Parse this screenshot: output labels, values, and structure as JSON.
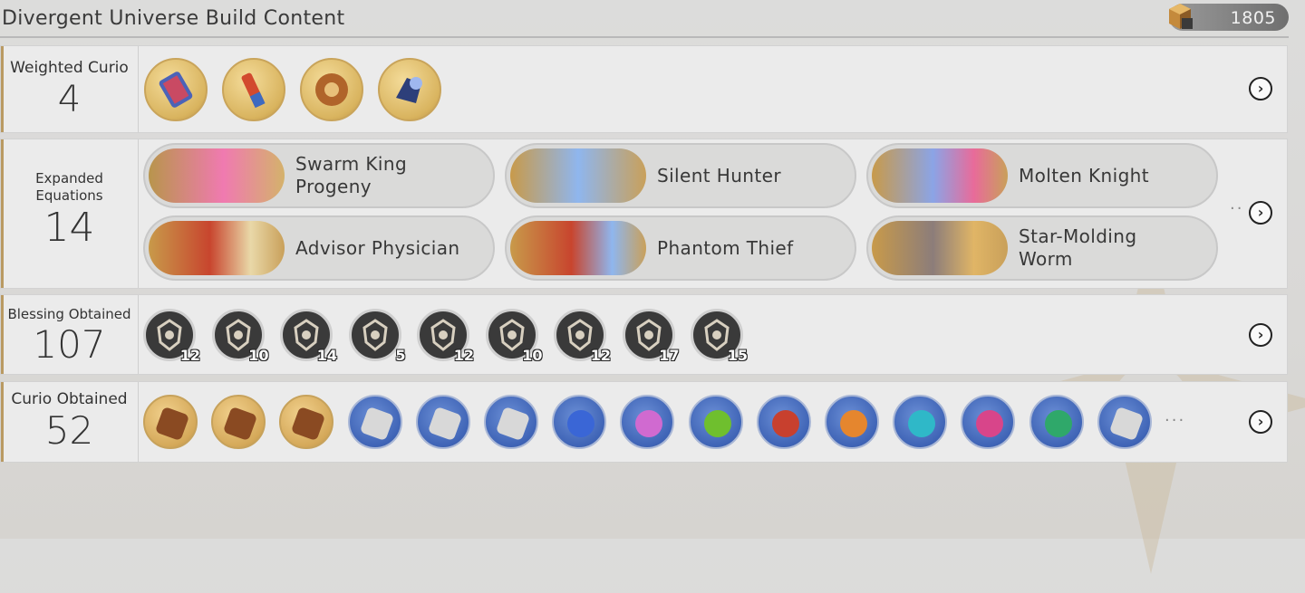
{
  "header": {
    "title": "Divergent Universe Build Content",
    "currency_value": "1805",
    "currency_icon": "cube-fragment-icon"
  },
  "weighted_curio": {
    "label": "Weighted Curio",
    "count": "4",
    "items": [
      {
        "icon": "can-curio-icon"
      },
      {
        "icon": "firecracker-curio-icon"
      },
      {
        "icon": "saw-blade-curio-icon"
      },
      {
        "icon": "mechanical-arm-curio-icon"
      }
    ]
  },
  "expanded_equations": {
    "label_line1": "Expanded",
    "label_line2": "Equations",
    "count": "14",
    "items": [
      {
        "name": "Swarm King Progeny",
        "line1": "Swarm King",
        "line2": "Progeny"
      },
      {
        "name": "Silent Hunter",
        "line1": "Silent Hunter",
        "line2": ""
      },
      {
        "name": "Molten Knight",
        "line1": "Molten Knight",
        "line2": ""
      },
      {
        "name": "Advisor Physician",
        "line1": "Advisor Physician",
        "line2": ""
      },
      {
        "name": "Phantom Thief",
        "line1": "Phantom Thief",
        "line2": ""
      },
      {
        "name": "Star-Molding Worm",
        "line1": "Star-Molding",
        "line2": "Worm"
      }
    ]
  },
  "blessings": {
    "label": "Blessing Obtained",
    "count": "107",
    "items": [
      {
        "icon": "preservation-path-icon",
        "count": "12"
      },
      {
        "icon": "remembrance-path-icon",
        "count": "10"
      },
      {
        "icon": "nihility-path-icon",
        "count": "14"
      },
      {
        "icon": "abundance-path-icon",
        "count": "5"
      },
      {
        "icon": "the-hunt-path-icon",
        "count": "12"
      },
      {
        "icon": "destruction-path-icon",
        "count": "10"
      },
      {
        "icon": "elation-path-icon",
        "count": "12"
      },
      {
        "icon": "propagation-path-icon",
        "count": "17"
      },
      {
        "icon": "erudition-path-icon",
        "count": "15"
      }
    ]
  },
  "curios": {
    "label": "Curio Obtained",
    "count": "52",
    "more": "···",
    "items": [
      {
        "icon": "scissors-curio-icon",
        "style": "gold"
      },
      {
        "icon": "armor-curio-icon",
        "style": "gold"
      },
      {
        "icon": "feather-curio-icon",
        "style": "gold"
      },
      {
        "icon": "pyramid-curio-icon",
        "style": "blue"
      },
      {
        "icon": "paint-tube-curio-icon",
        "style": "blue"
      },
      {
        "icon": "coins-curio-icon",
        "style": "blue"
      },
      {
        "icon": "blue-gem-curio-icon",
        "style": "blue"
      },
      {
        "icon": "pink-gem-curio-icon",
        "style": "blue"
      },
      {
        "icon": "green-gem-curio-icon",
        "style": "blue"
      },
      {
        "icon": "red-gem-curio-icon",
        "style": "blue"
      },
      {
        "icon": "orange-gem-curio-icon",
        "style": "blue"
      },
      {
        "icon": "cyan-gem-curio-icon",
        "style": "blue"
      },
      {
        "icon": "magenta-gem-curio-icon",
        "style": "blue"
      },
      {
        "icon": "emerald-gem-curio-icon",
        "style": "blue"
      },
      {
        "icon": "pinwheel-curio-icon",
        "style": "blue"
      }
    ]
  },
  "colors": {
    "accent_gold": "#b99a62",
    "panel_bg": "#ebebeb",
    "blessing_bg": "#3a3a3a",
    "curio_blue": "#3f64b6"
  }
}
